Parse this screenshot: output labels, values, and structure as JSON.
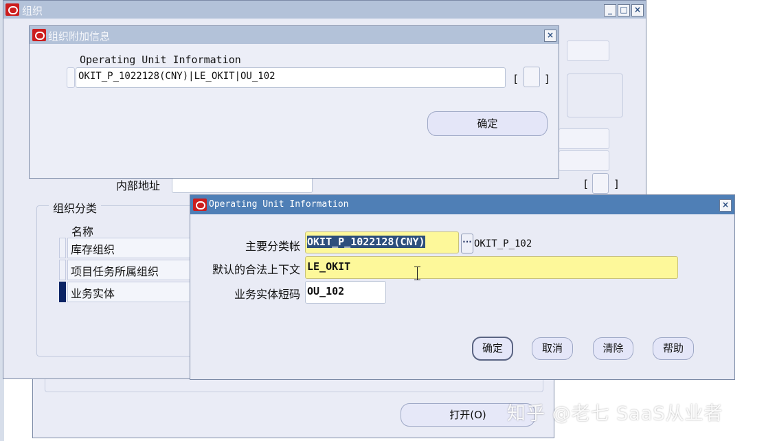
{
  "main_window": {
    "title": "组织",
    "internal_address_label": "内部地址",
    "classification_group_label": "组织分类",
    "name_column_header": "名称",
    "classifications": [
      "库存组织",
      "项目任务所属组织",
      "业务实体"
    ],
    "open_button": "打开(O)",
    "bracket_open": "[",
    "bracket_close": "]"
  },
  "extra_info_dialog": {
    "title": "组织附加信息",
    "heading": "Operating Unit Information",
    "value": "OKIT_P_1022128(CNY)|LE_OKIT|OU_102",
    "ok_button": "确定",
    "bracket_open": "[",
    "bracket_close": "]"
  },
  "ou_dialog": {
    "title": "Operating Unit Information",
    "primary_ledger_label": "主要分类帐",
    "primary_ledger_value": "OKIT_P_1022128(CNY)",
    "lov_button": "···",
    "primary_ledger_desc": "OKIT_P_102",
    "default_legal_context_label": "默认的合法上下文",
    "default_legal_context_value": "LE_OKIT",
    "ou_short_code_label": "业务实体短码",
    "ou_short_code_value": "OU_102",
    "buttons": {
      "ok": "确定",
      "cancel": "取消",
      "clear": "清除",
      "help": "帮助"
    }
  },
  "watermark": "知乎 @老七 SaaS从业者",
  "icons": [
    "oracle-logo-icon",
    "minimize-icon",
    "maximize-icon",
    "close-icon",
    "text-cursor-icon"
  ],
  "colors": {
    "active_title": "#4f7fb6",
    "inactive_title": "#b3c2d9",
    "required_field": "#fdf89a",
    "selection": "#2d4f7c"
  }
}
